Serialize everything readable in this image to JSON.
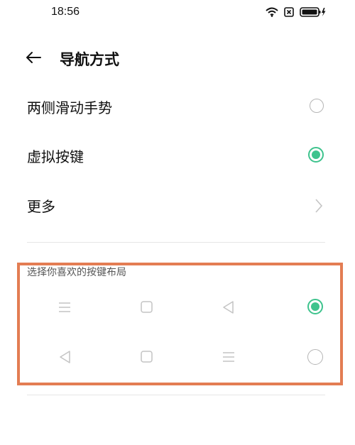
{
  "status_bar": {
    "time": "18:56",
    "icons": [
      "wifi-icon",
      "sim-off-icon",
      "battery-charging-icon"
    ]
  },
  "header": {
    "title": "导航方式"
  },
  "settings": {
    "gesture_label": "两侧滑动手势",
    "gesture_selected": false,
    "virtual_keys_label": "虚拟按键",
    "virtual_keys_selected": true,
    "more_label": "更多"
  },
  "key_layout": {
    "section_title": "选择你喜欢的按键布局",
    "options": [
      {
        "keys": [
          "menu-icon",
          "home-square-icon",
          "back-triangle-icon"
        ],
        "selected": true
      },
      {
        "keys": [
          "back-triangle-icon",
          "home-square-icon",
          "menu-icon"
        ],
        "selected": false
      }
    ]
  },
  "colors": {
    "accent": "#3ec38d",
    "highlight_border": "#e37d53",
    "muted_icon": "#c4c4c4"
  }
}
